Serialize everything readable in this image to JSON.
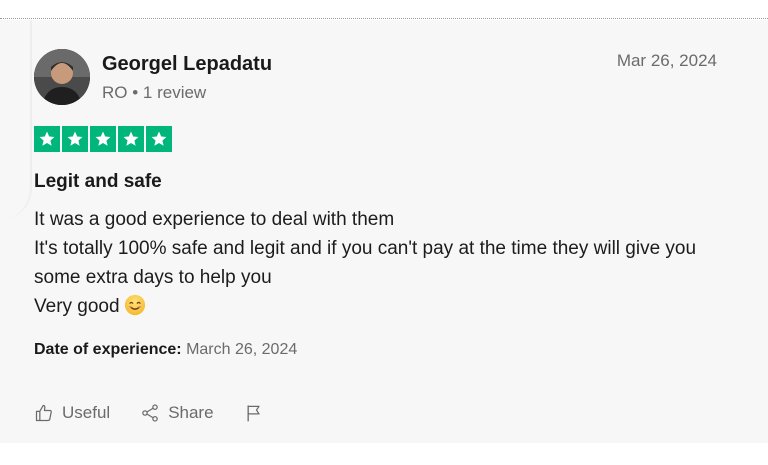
{
  "reviewer": {
    "name": "Georgel Lepadatu",
    "meta": "RO • 1 review"
  },
  "review": {
    "date": "Mar 26, 2024",
    "rating": 5,
    "rating_max": 5,
    "title": "Legit and safe",
    "body_lines": [
      "It was a good experience to deal with them",
      "It's totally 100% safe and legit and if you can't pay at the time they will give you some extra days to help you",
      "Very good"
    ],
    "experience_label": "Date of experience:",
    "experience_date": "March 26, 2024"
  },
  "actions": {
    "useful_label": "Useful",
    "share_label": "Share"
  },
  "colors": {
    "star_green": "#00b67a",
    "meta_gray": "#6b6b6b",
    "card_bg": "#f7f7f7"
  },
  "icons": {
    "useful": "thumbs-up-icon",
    "share": "share-icon",
    "report": "flag-icon",
    "emoji": "smiling-face-emoji"
  }
}
